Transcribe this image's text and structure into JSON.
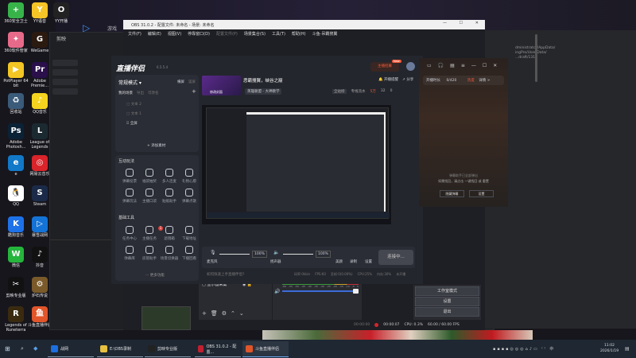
{
  "desktop": {
    "icons": [
      {
        "label": "360安全卫士",
        "color": "#37b34a",
        "glyph": "+"
      },
      {
        "label": "YY语音",
        "color": "#f5c426",
        "glyph": "Y"
      },
      {
        "label": "YY开播",
        "color": "#222",
        "glyph": "O"
      },
      {
        "label": "360软件管家",
        "color": "#e86a8a",
        "glyph": "✦"
      },
      {
        "label": "WeGame",
        "color": "#2b1a10",
        "glyph": "G"
      },
      {
        "label": "PotPlayer 64 bit",
        "color": "#f3c623",
        "glyph": "▶"
      },
      {
        "label": "Adobe Premie...",
        "color": "#2a0f4a",
        "glyph": "Pr"
      },
      {
        "label": "回收站",
        "color": "#3b5b7a",
        "glyph": "♻"
      },
      {
        "label": "QQ音乐",
        "color": "#f4d41e",
        "glyph": "♪"
      },
      {
        "label": "Adobe Photosh...",
        "color": "#0b2236",
        "glyph": "Ps"
      },
      {
        "label": "League of Legends",
        "color": "#1b2a30",
        "glyph": "L"
      },
      {
        "label": "e",
        "color": "#1278c8",
        "glyph": "e"
      },
      {
        "label": "网易云音乐",
        "color": "#d8242a",
        "glyph": "◎"
      },
      {
        "label": "QQ",
        "color": "#ffffff",
        "glyph": "🐧"
      },
      {
        "label": "Steam",
        "color": "#1b2a48",
        "glyph": "S"
      },
      {
        "label": "酷狗音乐",
        "color": "#1e72e8",
        "glyph": "K"
      },
      {
        "label": "暴雪战网",
        "color": "#1473d6",
        "glyph": "▷"
      },
      {
        "label": "微信",
        "color": "#25b53c",
        "glyph": "W"
      },
      {
        "label": "抖音",
        "color": "#111",
        "glyph": "♪"
      },
      {
        "label": "剪映专业版",
        "color": "#111",
        "glyph": "✂"
      },
      {
        "label": "炉石传说",
        "color": "#7a5a2a",
        "glyph": "⚙"
      },
      {
        "label": "Legends of Runeterra",
        "color": "#3a2a10",
        "glyph": "R"
      },
      {
        "label": "斗鱼直播伴侣",
        "color": "#e0552a",
        "glyph": "鱼"
      }
    ]
  },
  "background_app": {
    "label": "游戏",
    "name": "剪映"
  },
  "obs": {
    "title": "OBS 31.0.2 - 配置文件: 未命名 - 场景: 未命名",
    "menu": [
      "文件(F)",
      "编辑(E)",
      "视图(V)",
      "停靠窗口(D)",
      "配置文件(P)",
      "场景集合(S)",
      "工具(T)",
      "帮助(H)",
      "斗鱼-吊霸搜翼"
    ],
    "source": "显示器采集",
    "meter_ticks": [
      "-60",
      "-55",
      "-50",
      "-45",
      "-40",
      "-35",
      "-30",
      "-25",
      "-20",
      "-15",
      "-10",
      "-5",
      "0"
    ],
    "controls": [
      "工作室模式",
      "设置",
      "退出"
    ],
    "status": {
      "stream_time": "00:00:00",
      "rec_time": "00:00:07",
      "cpu": "CPU: 0.3%",
      "fps": "60.00 / 60.00 FPS"
    }
  },
  "companion": {
    "logo": "直播伴侣",
    "version": "6.5.5.4",
    "mode": "常规模式 ▾",
    "mode_links": [
      "横屏",
      "竖屏"
    ],
    "scene_tabs": [
      "我的场景",
      "导出",
      "可改名"
    ],
    "scenes": [
      "文本 2",
      "文本 1",
      "全屏"
    ],
    "add_material": "+ 添加素材",
    "room_title": "恶霸搜翼，峡谷之巅",
    "category": "英雄联盟 - 大神教学",
    "cover_edit": "修改封面",
    "top_actions": [
      "开播提醒",
      "分享"
    ],
    "live_badge": "主播招募",
    "new_badge": "New",
    "stats": {
      "all_station": "全站榜",
      "fans": "专线流水",
      "fans_val": "5万",
      "likes": "32",
      "hearts": "0"
    },
    "interactive_title": "互动玩法",
    "interactive": [
      "弹幕投票",
      "福袋抽奖",
      "多人连麦",
      "礼物心愿",
      "弹幕玩法",
      "主播口袋",
      "贴纸助手",
      "弹幕点歌"
    ],
    "tools_title": "基础工具",
    "tools": [
      "任务中心",
      "主播任务",
      "滤镜箱",
      "下载地址",
      "弹幕库",
      "房管助手",
      "场景切换器",
      "下播回看"
    ],
    "tools_badge": "1",
    "more": "··· 更多功能",
    "mic_label": "麦克风",
    "mic_vol": "100%",
    "spk_label": "扬声器",
    "spk_vol": "100%",
    "beauty": "美颜",
    "record": "录制",
    "settings": "设置",
    "go_live": "连接中...",
    "tip": "如何快速上手直播伴侣?",
    "bottom_stats": [
      "码率:0kb/s",
      "FPS:60",
      "丢帧:0(0.00%)",
      "CPU:25%",
      "内存:30%",
      "未开播"
    ],
    "side": {
      "label": "开播时长",
      "value": "0/420",
      "hot": "热度",
      "detail": "详情 >",
      "msg1": "弹幕助手已全部弹出",
      "msg2": "如需找回，请点击 一键找回 或 重置",
      "btn1": "隐藏弹幕",
      "btn2": "设置"
    }
  },
  "right_window": {
    "path": "dministrator/AppData/ ingPro/User Data/ ...draft/1315"
  },
  "taskbar": {
    "items": [
      "战网",
      "E:\\OBS录制",
      "剪映专业版",
      "OBS 31.0.2 - 配置...",
      "斗鱼直播伴侣"
    ],
    "time": "11:02",
    "date": "2026/1/19"
  }
}
